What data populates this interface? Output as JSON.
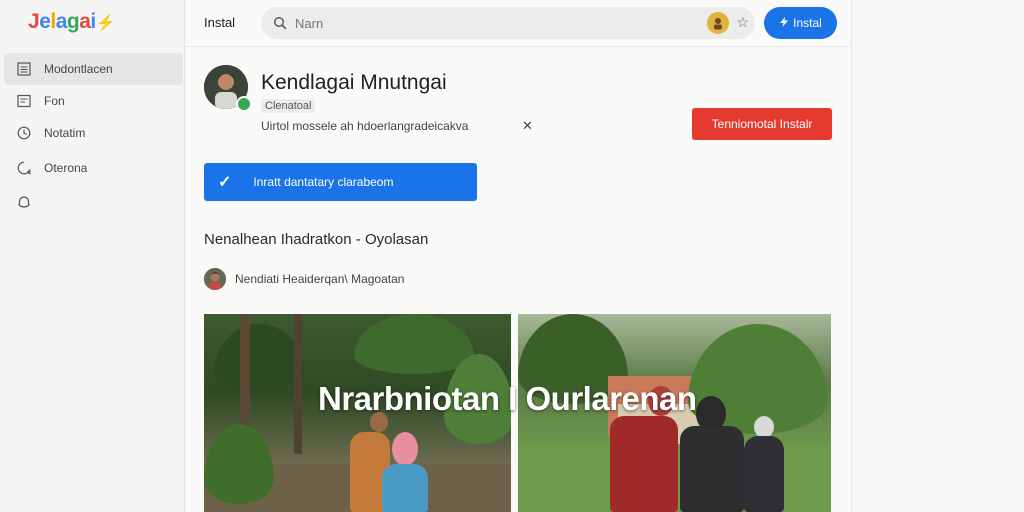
{
  "app": {
    "logo": "Jelagai"
  },
  "sidebar": {
    "items": [
      {
        "label": "Modontlacen",
        "icon": "document-icon",
        "active": true
      },
      {
        "label": "Fon",
        "icon": "list-icon",
        "active": false
      },
      {
        "label": "Notatim",
        "icon": "clock-icon",
        "active": false
      },
      {
        "label": "Oterona",
        "icon": "chat-icon",
        "active": false
      },
      {
        "label": "",
        "icon": "shape-icon",
        "active": false
      }
    ]
  },
  "topbar": {
    "page_label": "Instal",
    "search_placeholder": "Narn",
    "install_label": "Instal"
  },
  "profile": {
    "name": "Kendlagai Mnutngai",
    "tag": "Clenatoal",
    "description": "Uirtol mossele ah hdoerlangradeicakva",
    "action_label": "Tenniomotal Instalr"
  },
  "banner": {
    "label": "Inratt dantatary clarabeom"
  },
  "section": {
    "title": "Nenalhean Ihadratkon - Oyolasan",
    "author": "Nendiati Heaiderqan\\ Magoatan"
  },
  "media": {
    "overlay_text": "Nrarbniotan I Ourlarenan"
  },
  "colors": {
    "primary": "#1a73e8",
    "danger": "#e53a2f",
    "success": "#34a853"
  }
}
